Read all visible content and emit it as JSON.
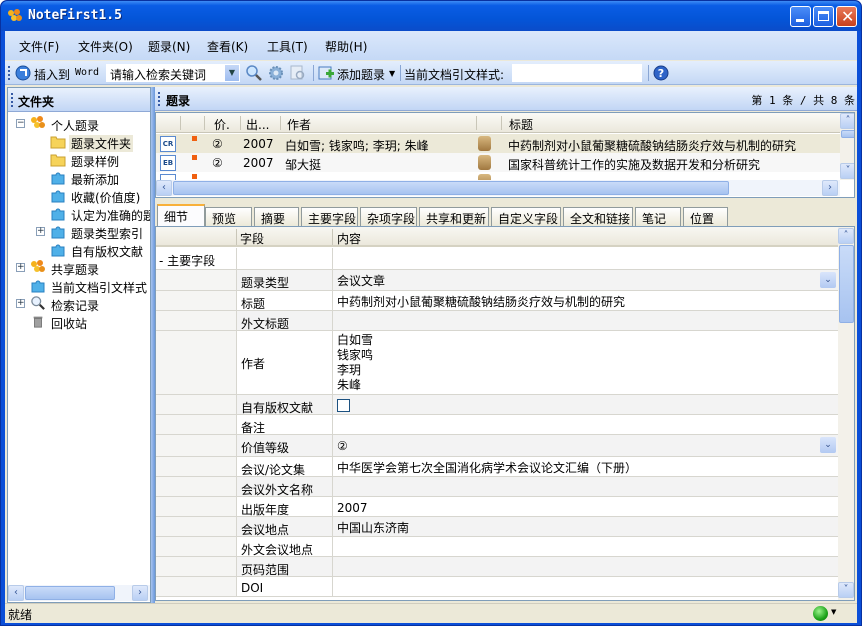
{
  "window": {
    "title": "NoteFirst1.5"
  },
  "menu": [
    "文件(F)",
    "文件夹(O)",
    "题录(N)",
    "查看(K)",
    "工具(T)",
    "帮助(H)"
  ],
  "toolbar": {
    "insert_label": "插入到",
    "word_label": "Word",
    "search_placeholder": "请输入检索关键词",
    "add_record_label": "添加题录",
    "cite_style_label": "当前文档引文样式:",
    "cite_style_value": ""
  },
  "left_panel": {
    "title": "文件夹",
    "tree": [
      {
        "label": "个人题录",
        "icon": "group-icon",
        "expander": "−"
      },
      {
        "label": "题录文件夹",
        "icon": "folder-icon",
        "selected": true
      },
      {
        "label": "题录样例",
        "icon": "folder-icon"
      },
      {
        "label": "最新添加",
        "icon": "puzzle-icon"
      },
      {
        "label": "收藏(价值度)",
        "icon": "puzzle-icon"
      },
      {
        "label": "认定为准确的题",
        "icon": "puzzle-icon"
      },
      {
        "label": "题录类型索引",
        "icon": "puzzle-icon",
        "expander": "+"
      },
      {
        "label": "自有版权文献",
        "icon": "puzzle-icon"
      },
      {
        "label": "共享题录",
        "icon": "group-icon",
        "expander": "+"
      },
      {
        "label": "当前文档引文样式",
        "icon": "puzzle-icon"
      },
      {
        "label": "检索记录",
        "icon": "magnifier-icon",
        "expander": "+"
      },
      {
        "label": "回收站",
        "icon": "trash-icon"
      }
    ]
  },
  "records": {
    "title": "题录",
    "pager": "第 1 条 / 共 8 条",
    "columns": [
      "价.",
      "出...",
      "作者",
      "标题"
    ],
    "rows": [
      {
        "type": "CR",
        "rating": "②",
        "year": "2007",
        "authors": "白如雪; 钱家鸣; 李玥; 朱峰",
        "title": "中药制剂对小鼠葡聚糖硫酸钠结肠炎疗效与机制的研究"
      },
      {
        "type": "EB",
        "rating": "②",
        "year": "2007",
        "authors": "邹大挺",
        "title": "国家科普统计工作的实施及数据开发和分析研究"
      }
    ]
  },
  "tabs": [
    "细节",
    "预览",
    "摘要",
    "主要字段",
    "杂项字段",
    "共享和更新",
    "自定义字段",
    "全文和链接",
    "笔记",
    "位置"
  ],
  "details": {
    "header": {
      "field": "字段",
      "content": "内容"
    },
    "group": "- 主要字段",
    "fields": [
      {
        "field": "题录类型",
        "value": "会议文章",
        "combo": true
      },
      {
        "field": "标题",
        "value": "中药制剂对小鼠葡聚糖硫酸钠结肠炎疗效与机制的研究"
      },
      {
        "field": "外文标题",
        "value": ""
      },
      {
        "field": "作者",
        "value": "白如雪\n钱家鸣\n李玥\n朱峰"
      },
      {
        "field": "自有版权文献",
        "value": "",
        "checkbox": false
      },
      {
        "field": "备注",
        "value": ""
      },
      {
        "field": "价值等级",
        "value": "②",
        "combo": true
      },
      {
        "field": "会议/论文集",
        "value": "中华医学会第七次全国消化病学术会议论文汇编（下册）"
      },
      {
        "field": "会议外文名称",
        "value": ""
      },
      {
        "field": "出版年度",
        "value": "2007"
      },
      {
        "field": "会议地点",
        "value": "中国山东济南"
      },
      {
        "field": "外文会议地点",
        "value": ""
      },
      {
        "field": "页码范围",
        "value": ""
      },
      {
        "field": "DOI",
        "value": ""
      }
    ]
  },
  "status": {
    "text": "就绪"
  }
}
